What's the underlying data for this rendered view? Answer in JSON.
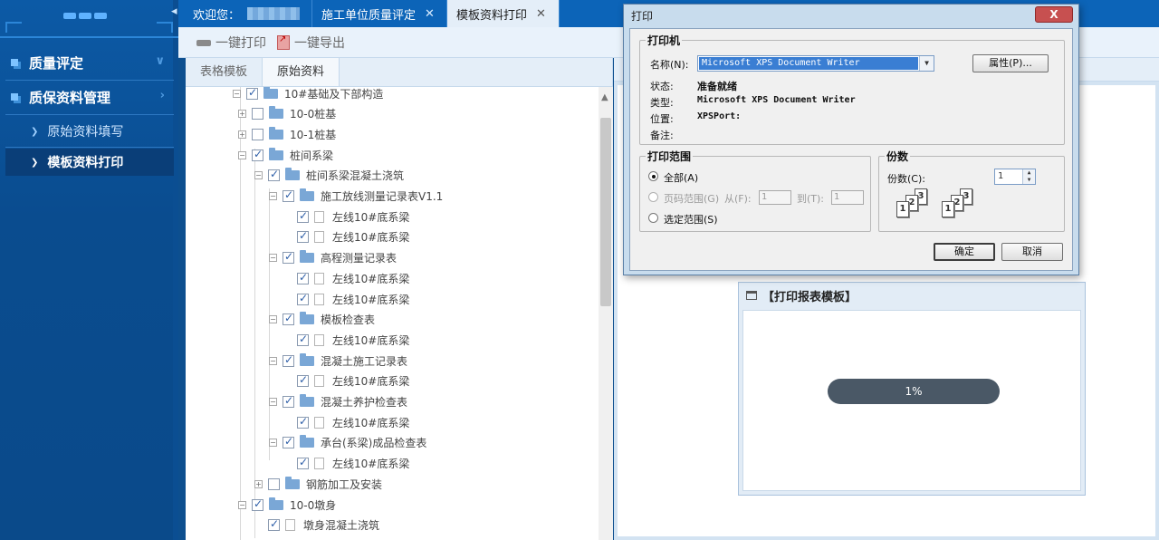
{
  "sidebar": {
    "items": [
      {
        "label": "质量评定",
        "chevron": "∨"
      },
      {
        "label": "质保资料管理",
        "chevron": "›"
      }
    ],
    "sub_items": [
      {
        "label": "原始资料填写"
      },
      {
        "label": "模板资料打印"
      }
    ]
  },
  "tabs": {
    "prev_icon": "◂",
    "welcome": "欢迎您：",
    "items": [
      {
        "label": "施工单位质量评定",
        "close": "✕"
      },
      {
        "label": "模板资料打印",
        "close": "✕"
      }
    ]
  },
  "toolbar": {
    "print_label": "一键打印",
    "export_label": "一键导出"
  },
  "left_panel": {
    "tabs": [
      "表格模板",
      "原始资料"
    ],
    "tree": [
      {
        "label": "10#基础及下部构造",
        "depth": 0,
        "expander": "−",
        "checked": true,
        "icon": "folder"
      },
      {
        "label": "10-0桩基",
        "depth": 1,
        "expander": "+",
        "checked": false,
        "icon": "folder"
      },
      {
        "label": "10-1桩基",
        "depth": 1,
        "expander": "+",
        "checked": false,
        "icon": "folder"
      },
      {
        "label": "桩间系梁",
        "depth": 1,
        "expander": "−",
        "checked": true,
        "icon": "folder"
      },
      {
        "label": "桩间系梁混凝土浇筑",
        "depth": 2,
        "expander": "−",
        "checked": true,
        "icon": "folder"
      },
      {
        "label": "施工放线测量记录表V1.1",
        "depth": 3,
        "expander": "−",
        "checked": true,
        "icon": "folder"
      },
      {
        "label": "左线10#底系梁",
        "depth": 4,
        "expander": "",
        "checked": true,
        "icon": "file"
      },
      {
        "label": "左线10#底系梁",
        "depth": 4,
        "expander": "",
        "checked": true,
        "icon": "file"
      },
      {
        "label": "高程测量记录表",
        "depth": 3,
        "expander": "−",
        "checked": true,
        "icon": "folder"
      },
      {
        "label": "左线10#底系梁",
        "depth": 4,
        "expander": "",
        "checked": true,
        "icon": "file"
      },
      {
        "label": "左线10#底系梁",
        "depth": 4,
        "expander": "",
        "checked": true,
        "icon": "file"
      },
      {
        "label": "模板检查表",
        "depth": 3,
        "expander": "−",
        "checked": true,
        "icon": "folder"
      },
      {
        "label": "左线10#底系梁",
        "depth": 4,
        "expander": "",
        "checked": true,
        "icon": "file"
      },
      {
        "label": "混凝土施工记录表",
        "depth": 3,
        "expander": "−",
        "checked": true,
        "icon": "folder"
      },
      {
        "label": "左线10#底系梁",
        "depth": 4,
        "expander": "",
        "checked": true,
        "icon": "file"
      },
      {
        "label": "混凝土养护检查表",
        "depth": 3,
        "expander": "−",
        "checked": true,
        "icon": "folder"
      },
      {
        "label": "左线10#底系梁",
        "depth": 4,
        "expander": "",
        "checked": true,
        "icon": "file"
      },
      {
        "label": "承台(系梁)成品检查表",
        "depth": 3,
        "expander": "−",
        "checked": true,
        "icon": "folder"
      },
      {
        "label": "左线10#底系梁",
        "depth": 4,
        "expander": "",
        "checked": true,
        "icon": "file"
      },
      {
        "label": "钢筋加工及安装",
        "depth": 2,
        "expander": "+",
        "checked": false,
        "icon": "folder"
      },
      {
        "label": "10-0墩身",
        "depth": 1,
        "expander": "−",
        "checked": true,
        "icon": "folder"
      },
      {
        "label": "墩身混凝土浇筑",
        "depth": 2,
        "expander": "",
        "checked": true,
        "icon": "file"
      }
    ],
    "scroll_up_icon": "▲"
  },
  "print_dialog": {
    "title": "打印",
    "close_label": "X",
    "printer_group": "打印机",
    "name_label": "名称(N):",
    "name_value": "Microsoft XPS Document Writer",
    "dropdown_icon": "▼",
    "properties_button": "属性(P)...",
    "status_label": "状态:",
    "status_value": "准备就绪",
    "type_label": "类型:",
    "type_value": "Microsoft XPS Document Writer",
    "where_label": "位置:",
    "where_value": "XPSPort:",
    "comment_label": "备注:",
    "range_group": "打印范围",
    "range_all": "全部(A)",
    "range_pages": "页码范围(G)",
    "range_from_label": "从(F):",
    "range_from_value": "1",
    "range_to_label": "到(T):",
    "range_to_value": "1",
    "range_selection": "选定范围(S)",
    "copies_group": "份数",
    "copies_label": "份数(C):",
    "copies_value": "1",
    "collate_pages": [
      "1",
      "2",
      "3"
    ],
    "ok_button": "确定",
    "cancel_button": "取消"
  },
  "template_panel": {
    "title": "【打印报表模板】",
    "progress_text": "1%",
    "progress_value": 0.01
  },
  "colors": {
    "sidebar_bg": "#0a4c8f",
    "tab_active_bg": "#e4eef8",
    "progress_bg": "#4a5866"
  }
}
